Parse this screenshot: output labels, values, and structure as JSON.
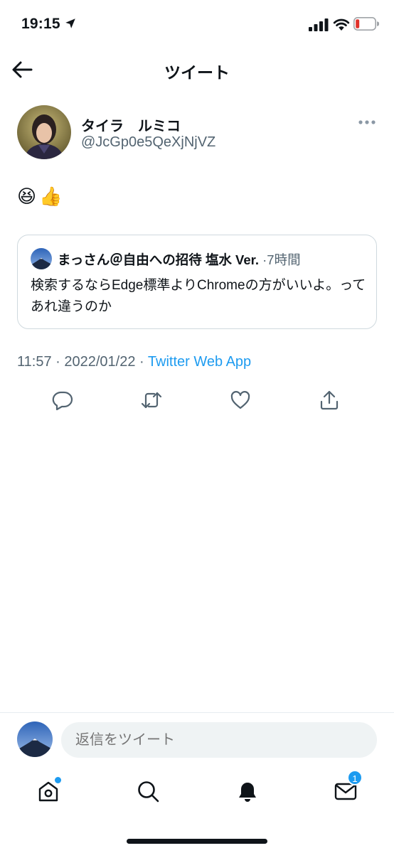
{
  "status_bar": {
    "time": "19:15",
    "icons": [
      "location-arrow-icon",
      "cellular-signal-icon",
      "wifi-icon",
      "battery-low-icon"
    ],
    "battery_color": "#e0322b"
  },
  "header": {
    "back_icon": "arrow-left-icon",
    "title": "ツイート"
  },
  "tweet": {
    "author_name": "タイラ　ルミコ",
    "author_handle": "@JcGp0e5QeXjNjVZ",
    "text": "😆👍",
    "quote": {
      "name": "まっさん＠自由への招待 塩水 Ver.",
      "separator": "·",
      "time": "7時間",
      "text": "検索するならEdge標準よりChromeの方がいいよ。ってあれ違うのか"
    },
    "time": "11:57",
    "date": "2022/01/22",
    "meta_sep": "·",
    "source": "Twitter Web App",
    "actions": [
      "reply-icon",
      "retweet-icon",
      "like-icon",
      "share-icon"
    ]
  },
  "reply_bar": {
    "placeholder": "返信をツイート"
  },
  "tab_bar": {
    "tabs": [
      "home-icon",
      "search-icon",
      "notifications-icon",
      "messages-icon"
    ],
    "messages_badge": "1"
  },
  "colors": {
    "accent": "#1d9bf0",
    "text": "#0f1419",
    "secondary": "#536471",
    "border": "#cfd9de"
  }
}
